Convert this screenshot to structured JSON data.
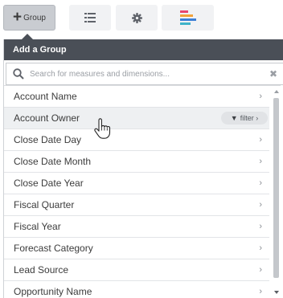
{
  "toolbar": {
    "group_button": {
      "icon": "plus-icon",
      "label": "Group"
    },
    "list_button": {
      "icon": "list-icon"
    },
    "settings_button": {
      "icon": "gear-icon"
    },
    "chart_button": {
      "icon": "bar-chart-icon",
      "colors": [
        "#e8466f",
        "#f2a33a",
        "#3d7fd6",
        "#3fb3c9"
      ]
    }
  },
  "panel": {
    "title": "Add a Group",
    "search": {
      "placeholder": "Search for measures and dimensions...",
      "value": "",
      "clear_icon": "close-icon"
    },
    "items": [
      {
        "label": "Account Name",
        "chevron": "›"
      },
      {
        "label": "Account Owner",
        "chevron": "›",
        "hovered": true,
        "filter": "filter ›"
      },
      {
        "label": "Close Date Day",
        "chevron": "›"
      },
      {
        "label": "Close Date Month",
        "chevron": "›"
      },
      {
        "label": "Close Date Year",
        "chevron": "›"
      },
      {
        "label": "Fiscal Quarter",
        "chevron": "›"
      },
      {
        "label": "Fiscal Year",
        "chevron": "›"
      },
      {
        "label": "Forecast Category",
        "chevron": "›"
      },
      {
        "label": "Lead Source",
        "chevron": "›"
      },
      {
        "label": "Opportunity Name",
        "chevron": "›"
      }
    ]
  },
  "colors": {
    "header_bg": "#4a4f57",
    "hover_bg": "#eef0f2",
    "active_button": "#c9ccd1"
  }
}
